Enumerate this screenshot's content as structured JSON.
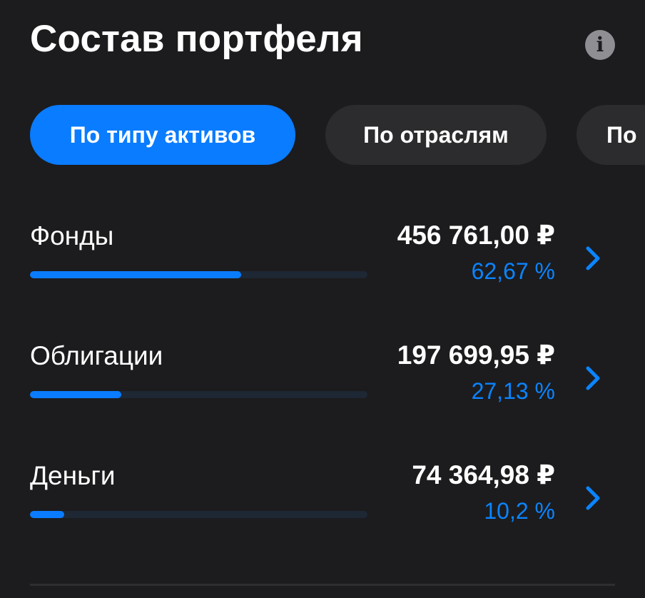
{
  "header": {
    "title": "Состав портфеля",
    "info_icon": "info-icon"
  },
  "tabs": [
    {
      "label": "По типу активов",
      "active": true
    },
    {
      "label": "По отраслям",
      "active": false
    },
    {
      "label": "По",
      "active": false
    }
  ],
  "allocations": [
    {
      "label": "Фонды",
      "amount": "456 761,00 ₽",
      "percent": "62,67 %",
      "share": 0.6267
    },
    {
      "label": "Облигации",
      "amount": "197 699,95 ₽",
      "percent": "27,13 %",
      "share": 0.2713
    },
    {
      "label": "Деньги",
      "amount": "74 364,98 ₽",
      "percent": "10,2 %",
      "share": 0.102
    }
  ],
  "colors": {
    "background": "#1c1c1e",
    "accent": "#0a7cff",
    "percent_text": "#0a84ff",
    "tab_inactive": "#2c2c2e",
    "bar_track": "#1e2734"
  }
}
